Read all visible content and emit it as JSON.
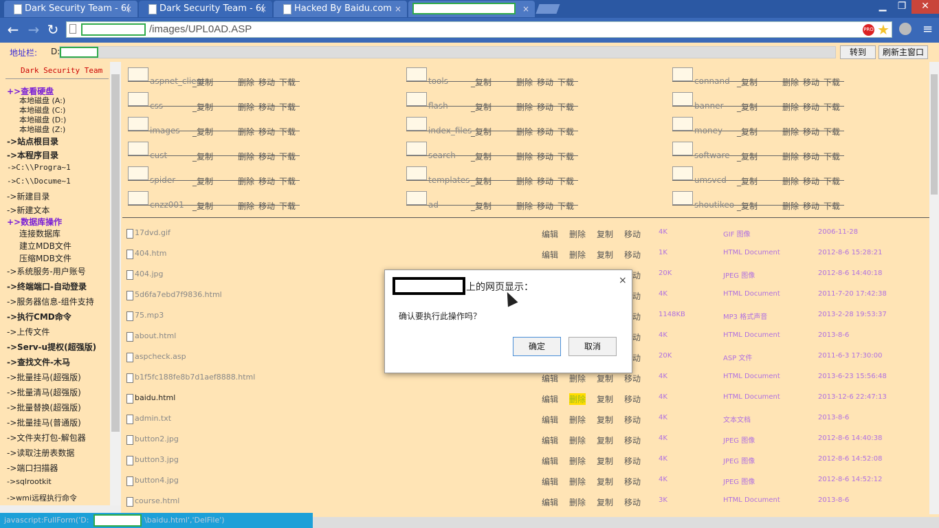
{
  "browser": {
    "tabs": [
      {
        "label": "Dark Security Team - 6("
      },
      {
        "label": "Dark Security Team - 6("
      },
      {
        "label": "Hacked By Baidu.com"
      },
      {
        "label": ""
      }
    ],
    "close_glyph": "×",
    "url_path": "/images/UPL0AD.ASP",
    "pro_badge": "PRO"
  },
  "page_bar": {
    "address_label": "地址栏:",
    "drive": "D:",
    "go_button": "转到",
    "refresh_button": "刷新主窗口"
  },
  "left_panel": {
    "title": "Dark Security Team",
    "view_disk": "+>查看硬盘",
    "disks": [
      "本地磁盘 (A:)",
      "本地磁盘 (C:)",
      "本地磁盘 (D:)",
      "本地磁盘 (Z:)"
    ],
    "items_a": [
      "->站点根目录",
      "->本程序目录",
      "->C:\\\\Progra~1",
      "->C:\\\\Docume~1",
      "->新建目录",
      "->新建文本"
    ],
    "db_title": "+>数据库操作",
    "db_items": [
      "连接数据库",
      "建立MDB文件",
      "压缩MDB文件"
    ],
    "items_b": [
      "->系统服务-用户账号",
      "->终端端口-自动登录",
      "->服务器信息-组件支持",
      "->执行CMD命令",
      "->上传文件",
      "->Serv-u提权(超强版)",
      "->查找文件-木马",
      "->批量挂马(超强版)",
      "->批量清马(超强版)",
      "->批量替换(超强版)",
      "->批量挂马(普通版)",
      "->文件夹打包-解包器",
      "->读取注册表数据",
      "->端口扫描器",
      "->sqlrootkit",
      "->wmi远程执行命令"
    ]
  },
  "folders": {
    "actions": {
      "copy": "_复制",
      "delete": "删除",
      "move": "移动",
      "download": "下载"
    },
    "names": [
      "aspnet_client",
      "css",
      "images",
      "cust",
      "spider",
      "cnzz001",
      "tools",
      "flash",
      "index_files",
      "search",
      "templates",
      "ad",
      "connand",
      "banner",
      "money",
      "software",
      "umsvcd",
      "shoutikeo"
    ]
  },
  "files": {
    "actions": {
      "edit": "编辑",
      "delete": "删除",
      "copy": "复制",
      "move": "移动"
    },
    "rows": [
      {
        "name": "17dvd.gif",
        "size": "4K",
        "type": "GIF 图像",
        "date": "2006-11-28"
      },
      {
        "name": "404.htm",
        "size": "1K",
        "type": "HTML Document",
        "date": "2012-8-6 15:28:21"
      },
      {
        "name": "404.jpg",
        "size": "20K",
        "type": "JPEG 图像",
        "date": "2012-8-6 14:40:18"
      },
      {
        "name": "5d6fa7ebd7f9836.html",
        "size": "4K",
        "type": "HTML Document",
        "date": "2011-7-20 17:42:38"
      },
      {
        "name": "75.mp3",
        "size": "1148KB",
        "type": "MP3 格式声音",
        "date": "2013-2-28 19:53:37"
      },
      {
        "name": "about.html",
        "size": "4K",
        "type": "HTML Document",
        "date": "2013-8-6"
      },
      {
        "name": "aspcheck.asp",
        "size": "20K",
        "type": "ASP 文件",
        "date": "2011-6-3 17:30:00"
      },
      {
        "name": "b1f5fc188fe8b7d1aef8888.html",
        "size": "4K",
        "type": "HTML Document",
        "date": "2013-6-23 15:56:48"
      },
      {
        "name": "baidu.html",
        "size": "4K",
        "type": "HTML Document",
        "date": "2013-12-6 22:47:13"
      },
      {
        "name": "admin.txt",
        "size": "4K",
        "type": "文本文档",
        "date": "2013-8-6"
      },
      {
        "name": "button2.jpg",
        "size": "4K",
        "type": "JPEG 图像",
        "date": "2012-8-6 14:40:38"
      },
      {
        "name": "button3.jpg",
        "size": "4K",
        "type": "JPEG 图像",
        "date": "2012-8-6 14:52:08"
      },
      {
        "name": "button4.jpg",
        "size": "4K",
        "type": "JPEG 图像",
        "date": "2012-8-6 14:52:12"
      },
      {
        "name": "course.html",
        "size": "3K",
        "type": "HTML Document",
        "date": "2013-8-6"
      }
    ]
  },
  "dialog": {
    "title_suffix": "上的网页显示：",
    "message": "确认要执行此操作吗？",
    "ok": "确定",
    "cancel": "取消",
    "close_glyph": "×"
  },
  "status_bar": {
    "text": "javascript:FullForm('D:",
    "text_tail": "\\baidu.html','DelFile')"
  }
}
